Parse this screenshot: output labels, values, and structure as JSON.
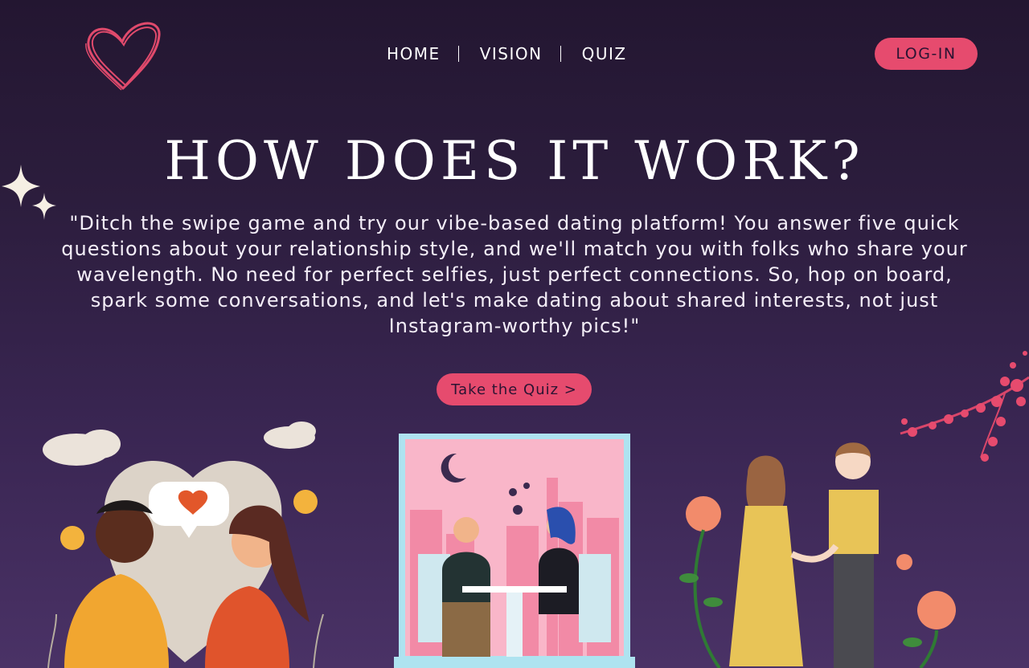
{
  "brand": {
    "logo": "heart-logo-icon"
  },
  "nav": {
    "items": [
      {
        "label": "HOME"
      },
      {
        "label": "VISION"
      },
      {
        "label": "QUIZ"
      }
    ],
    "login_label": "LOG-IN"
  },
  "hero": {
    "title": "HOW DOES IT WORK?",
    "description": "\"Ditch the swipe game and try our vibe-based dating platform! You answer five quick questions about your relationship style, and we'll match you with folks who share your wavelength. No need for perfect selfies, just perfect connections. So, hop on board, spark some conversations, and let's make dating about shared interests, not just Instagram-worthy pics!\"",
    "cta_label": "Take the Quiz >"
  },
  "illustrations": [
    {
      "icon": "couple-texting-illustration"
    },
    {
      "icon": "couple-dining-illustration"
    },
    {
      "icon": "couple-holding-hands-illustration"
    }
  ],
  "colors": {
    "accent": "#e64b6e",
    "background_top": "#231631",
    "background_bottom": "#4a3266"
  }
}
